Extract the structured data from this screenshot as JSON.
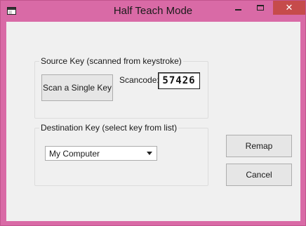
{
  "window": {
    "title": "Half Teach Mode",
    "close_glyph": "✕",
    "chrome_color": "#d96aa6"
  },
  "source": {
    "label": "Source Key (scanned from keystroke)",
    "scan_button": "Scan a Single Key",
    "scancode_label": "Scancode:",
    "scancode_value": "57426"
  },
  "destination": {
    "label": "Destination Key (select key from list)",
    "selected_key": "My Computer"
  },
  "buttons": {
    "remap": "Remap",
    "cancel": "Cancel"
  }
}
